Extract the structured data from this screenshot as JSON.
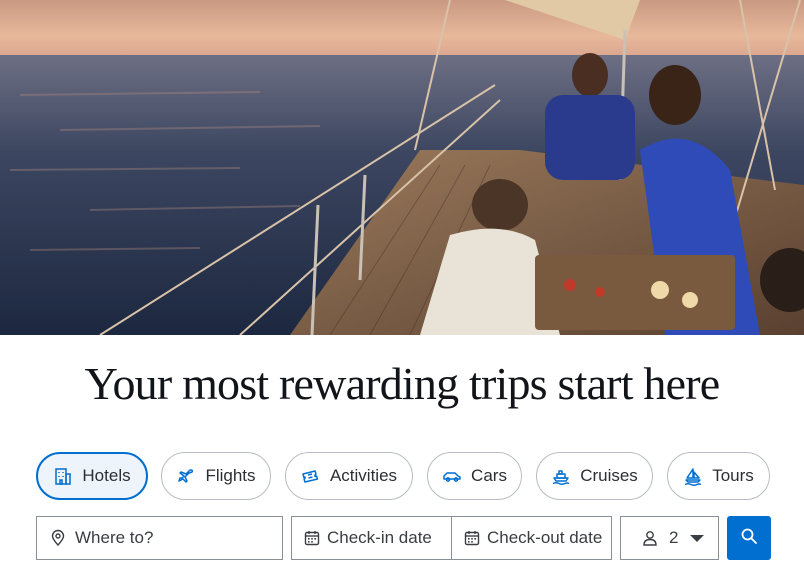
{
  "hero": {
    "image": "sunset-sailboat-friends-toasting"
  },
  "headline": "Your most rewarding trips start here",
  "categories": [
    {
      "label": "Hotels",
      "icon": "hotel-icon",
      "selected": true
    },
    {
      "label": "Flights",
      "icon": "plane-icon",
      "selected": false
    },
    {
      "label": "Activities",
      "icon": "ticket-icon",
      "selected": false
    },
    {
      "label": "Cars",
      "icon": "car-icon",
      "selected": false
    },
    {
      "label": "Cruises",
      "icon": "ship-icon",
      "selected": false
    },
    {
      "label": "Tours",
      "icon": "sailboat-icon",
      "selected": false
    }
  ],
  "search": {
    "destination_placeholder": "Where to?",
    "checkin_label": "Check-in date",
    "checkout_label": "Check-out date",
    "travelers_count": "2"
  },
  "colors": {
    "accent": "#006fcf",
    "active_pill_bg": "#eef4fb",
    "headline": "#111418"
  }
}
